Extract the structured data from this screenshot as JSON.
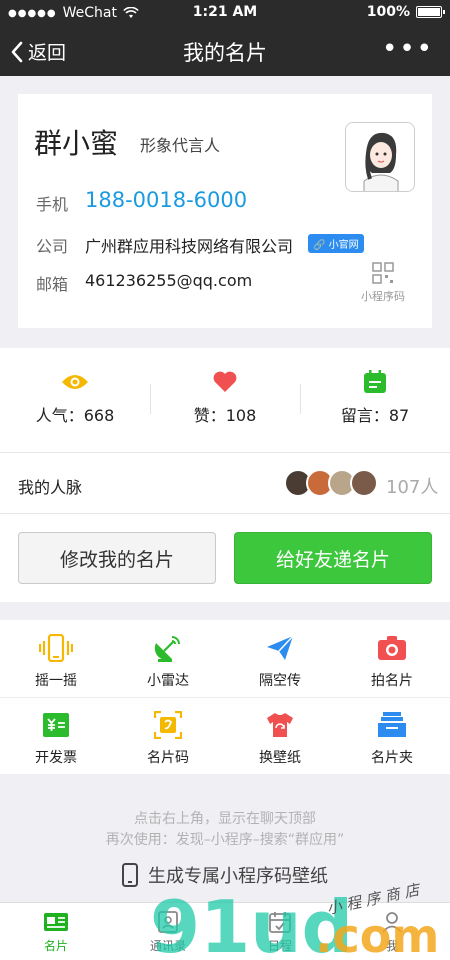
{
  "status": {
    "carrier": "WeChat",
    "time": "1:21 AM",
    "battery": "100%"
  },
  "nav": {
    "back_label": "返回",
    "title": "我的名片"
  },
  "card": {
    "name": "群小蜜",
    "role": "形象代言人",
    "phone_label": "手机",
    "phone": "188-0018-6000",
    "company_label": "公司",
    "company": "广州群应用科技网络有限公司",
    "company_badge": "小官网",
    "email_label": "邮箱",
    "email": "461236255@qq.com",
    "mini_code_label": "小程序码"
  },
  "stats": [
    {
      "label": "人气：668",
      "icon": "eye-icon",
      "color": "#f5b800"
    },
    {
      "label": "赞：108",
      "icon": "heart-icon",
      "color": "#f0504f"
    },
    {
      "label": "留言：87",
      "icon": "calendar-icon",
      "color": "#2cbb2c"
    }
  ],
  "network": {
    "label": "我的人脉",
    "count": "107人"
  },
  "actions": {
    "edit_label": "修改我的名片",
    "send_label": "给好友递名片"
  },
  "tools": [
    {
      "label": "摇一摇",
      "icon": "shake-phone-icon",
      "color": "#f5b800"
    },
    {
      "label": "小雷达",
      "icon": "radar-icon",
      "color": "#2cbb2c"
    },
    {
      "label": "隔空传",
      "icon": "paper-plane-icon",
      "color": "#2d8cf0"
    },
    {
      "label": "拍名片",
      "icon": "camera-icon",
      "color": "#f0504f"
    },
    {
      "label": "开发票",
      "icon": "invoice-icon",
      "color": "#2cbb2c"
    },
    {
      "label": "名片码",
      "icon": "card-code-icon",
      "color": "#f5b800"
    },
    {
      "label": "换壁纸",
      "icon": "shirt-icon",
      "color": "#f0504f"
    },
    {
      "label": "名片夹",
      "icon": "card-box-icon",
      "color": "#2d8cf0"
    }
  ],
  "tips": {
    "line1": "点击右上角，显示在聊天顶部",
    "line2": "再次使用：发现–小程序–搜索“群应用”",
    "generate_label": "生成专属小程序码壁纸"
  },
  "tabbar": [
    {
      "label": "名片",
      "icon": "card-tab-icon",
      "active": true
    },
    {
      "label": "通讯录",
      "icon": "contacts-tab-icon",
      "active": false
    },
    {
      "label": "日程",
      "icon": "schedule-tab-icon",
      "active": false
    },
    {
      "label": "我",
      "icon": "me-tab-icon",
      "active": false
    }
  ],
  "watermark": {
    "main": "91ud.com",
    "sub": "小 程 序 商 店"
  }
}
